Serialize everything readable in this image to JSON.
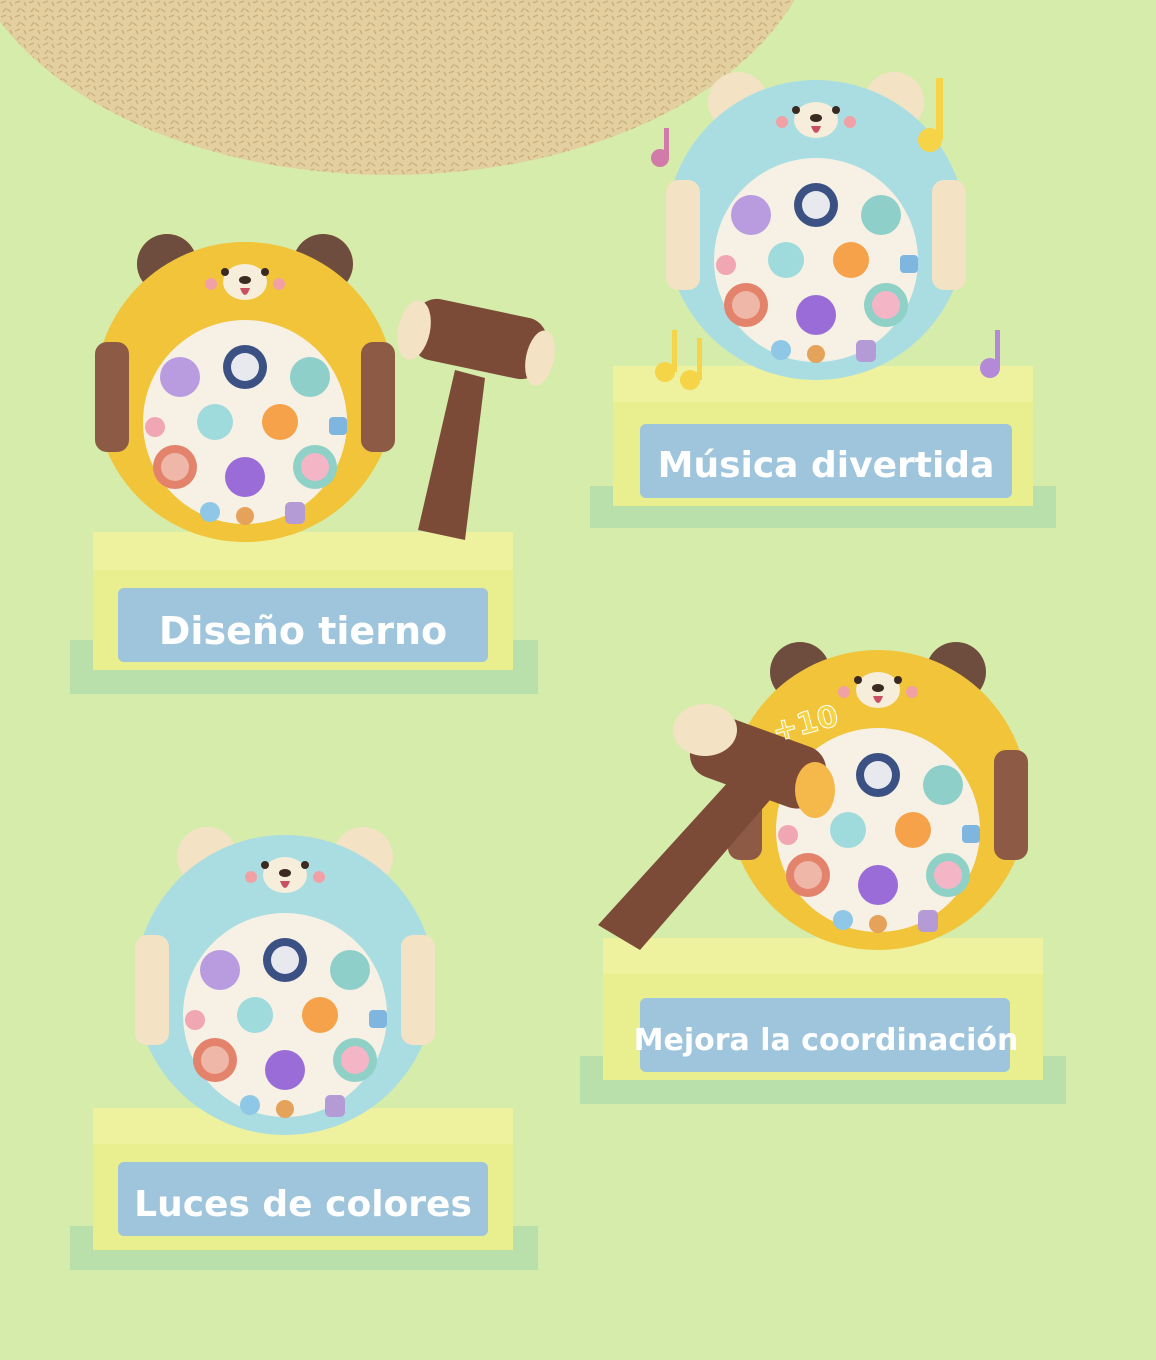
{
  "colors": {
    "background": "#d6ecab",
    "rug": "#e3cf9f",
    "pedestal_top": "#eef29f",
    "pedestal_front": "#e9ee8e",
    "pedestal_base": "#b9dfaa",
    "label_box": "#9ec5dc",
    "toy_yellow": "#f1c43a",
    "toy_blue": "#a9dde2",
    "toy_brown": "#8c5a45",
    "hammer": "#7c4b38",
    "note_yellow": "#f5d447",
    "note_pink": "#d27ba8",
    "note_purple": "#b48ad8"
  },
  "panels": [
    {
      "id": "cute-design",
      "caption": "Diseño tierno",
      "toy_color": "yellow",
      "icon": "whack-a-mole-toy-with-hammer"
    },
    {
      "id": "fun-music",
      "caption": "Música divertida",
      "toy_color": "blue",
      "icon": "whack-a-mole-toy-with-music-notes"
    },
    {
      "id": "colorful-lights",
      "caption": "Luces de colores",
      "toy_color": "blue",
      "icon": "whack-a-mole-toy"
    },
    {
      "id": "coordination",
      "caption": "Mejora la coordinación",
      "toy_color": "yellow",
      "icon": "whack-a-mole-toy-hit-by-hammer",
      "score_badge": "+10"
    }
  ]
}
